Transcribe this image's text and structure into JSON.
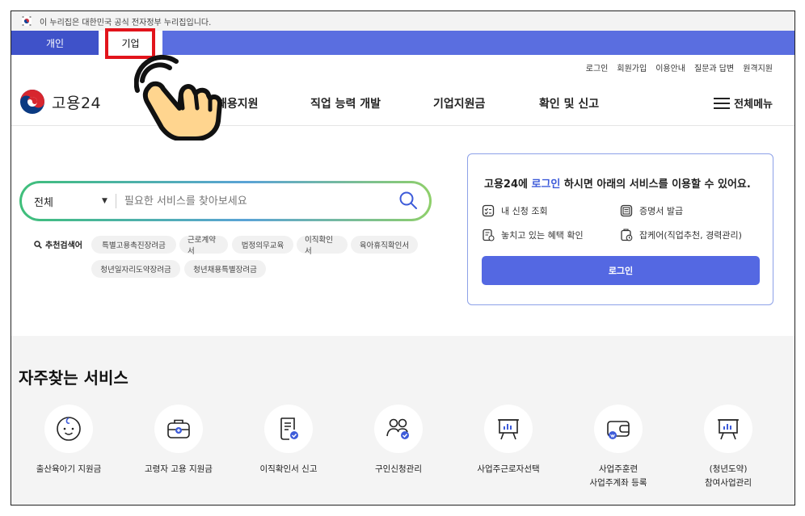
{
  "gov_banner": {
    "text": "이 누리집은 대한민국 공식 전자정부 누리집입니다."
  },
  "user_type_tabs": [
    {
      "label": "개인"
    },
    {
      "label": "기업"
    }
  ],
  "utility_links": [
    "로그인",
    "회원가입",
    "이용안내",
    "질문과 답변",
    "원격지원"
  ],
  "logo": {
    "text": "고용24"
  },
  "gnb": [
    "채용지원",
    "직업 능력 개발",
    "기업지원금",
    "확인 및 신고"
  ],
  "all_menu": {
    "label": "전체메뉴"
  },
  "search": {
    "category": "전체",
    "placeholder": "필요한 서비스를 찾아보세요",
    "recommended_label": "추천검색어",
    "keywords": [
      "특별고용촉진장려금",
      "근로계약서",
      "법정의무교육",
      "이직확인서",
      "육아휴직확인서",
      "청년일자리도약장려금",
      "청년채용특별장려금"
    ]
  },
  "login_panel": {
    "title_prefix": "고용24에 ",
    "title_link": "로그인",
    "title_suffix": " 하시면 아래의 서비스를 이용할 수 있어요.",
    "services": [
      "내 신청 조회",
      "증명서 발급",
      "놓치고 있는 혜택 확인",
      "잡케어(직업추천, 경력관리)"
    ],
    "button": "로그인"
  },
  "frequent_services": {
    "title": "자주찾는 서비스",
    "items": [
      {
        "line1": "출산육아기 지원금",
        "line2": "",
        "icon": "baby-icon"
      },
      {
        "line1": "고령자 고용 지원금",
        "line2": "",
        "icon": "briefcase-icon"
      },
      {
        "line1": "이직확인서 신고",
        "line2": "",
        "icon": "document-check-icon"
      },
      {
        "line1": "구인신청관리",
        "line2": "",
        "icon": "people-icon"
      },
      {
        "line1": "사업주근로자선택",
        "line2": "",
        "icon": "easel-chart-icon"
      },
      {
        "line1": "사업주훈련",
        "line2": "사업주계좌 등록",
        "icon": "wallet-icon"
      },
      {
        "line1": "(청년도약)",
        "line2": "참여사업관리",
        "icon": "easel-chart-icon"
      }
    ]
  },
  "colors": {
    "primary": "#5a6ee0",
    "accent_text": "#3d5bd9",
    "highlight": "#e2141b"
  }
}
